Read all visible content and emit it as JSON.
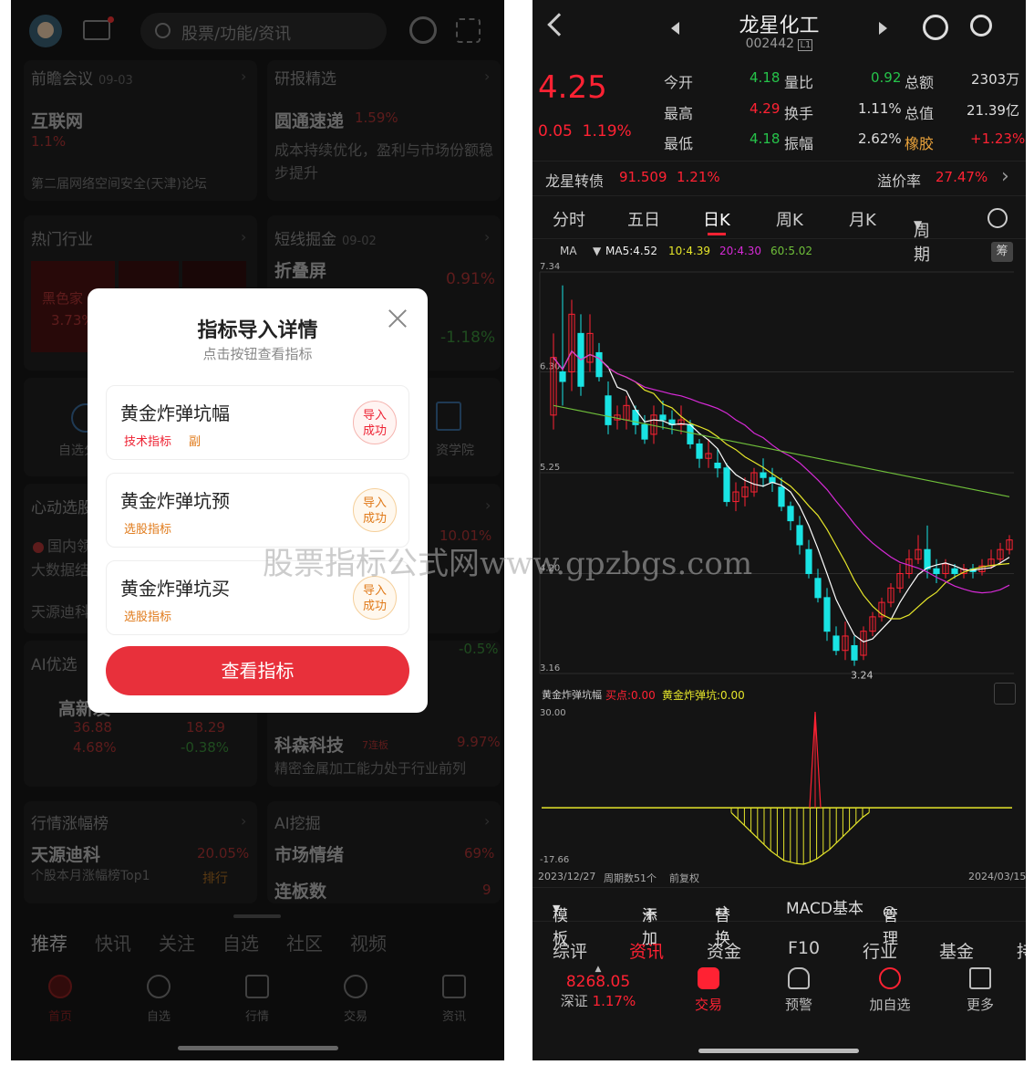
{
  "left": {
    "search_placeholder": "股票/功能/资讯",
    "cards": {
      "qianzhan": {
        "title": "前瞻会议",
        "date": "09-03",
        "main": "互联网",
        "pct": "1.1%",
        "desc": "第二届网络空间安全(天津)论坛"
      },
      "yanbao": {
        "title": "研报精选",
        "main": "圆通速递",
        "pct": "1.59%",
        "desc": "成本持续优化，盈利与市场份额稳步提升"
      },
      "remen": {
        "title": "热门行业",
        "item": "黑色家",
        "pct": "3.73%"
      },
      "duanxian": {
        "title": "短线掘金",
        "date": "09-02",
        "main": "折叠屏",
        "pct1": "0.91%",
        "pct2": "-1.18%"
      },
      "shortcuts": {
        "a": "自选分",
        "b": "资学院"
      },
      "xindong": {
        "title": "心动选股",
        "item1": "国内领",
        "item2": "大数据结",
        "pct": "10.01%",
        "item3": "天源迪科"
      },
      "aiyou": {
        "title": "AI优选",
        "stock1": "高新发",
        "v1": "36.88",
        "p1": "4.68%",
        "v2": "18.29",
        "p2": "-0.38%",
        "pct": "-0.5%"
      },
      "kesen": {
        "main": "科森科技",
        "tag": "7连板",
        "pct": "9.97%",
        "desc": "精密金属加工能力处于行业前列"
      },
      "zhangfu": {
        "title": "行情涨幅榜",
        "main": "天源迪科",
        "pct": "20.05%",
        "desc": "个股本月涨幅榜Top1",
        "link": "排行"
      },
      "aijue": {
        "title": "AI挖掘",
        "main": "市场情绪",
        "pct": "69%",
        "sub": "连板数",
        "num": "9"
      }
    },
    "tabs": [
      "推荐",
      "快讯",
      "关注",
      "自选",
      "社区",
      "视频"
    ],
    "nav": [
      "首页",
      "自选",
      "行情",
      "交易",
      "资讯"
    ]
  },
  "modal": {
    "title": "指标导入详情",
    "subtitle": "点击按钮查看指标",
    "items": [
      {
        "name": "黄金炸弹坑幅",
        "tag": "技术指标",
        "tag2": "副",
        "status": [
          "导入",
          "成功"
        ]
      },
      {
        "name": "黄金炸弹坑预",
        "tag": "选股指标",
        "status": [
          "导入",
          "成功"
        ]
      },
      {
        "name": "黄金炸弹坑买",
        "tag": "选股指标",
        "status": [
          "导入",
          "成功"
        ]
      }
    ],
    "button": "查看指标"
  },
  "right": {
    "stock_name": "龙星化工",
    "stock_code": "002442",
    "code_badge": "L1",
    "price": "4.25",
    "change": "0.05",
    "change_pct": "1.19%",
    "quote": {
      "open_label": "今开",
      "open": "4.18",
      "high_label": "最高",
      "high": "4.29",
      "low_label": "最低",
      "low": "4.18",
      "vr_label": "量比",
      "vr": "0.92",
      "turn_label": "换手",
      "turn": "1.11%",
      "amp_label": "振幅",
      "amp": "2.62%",
      "amt_label": "总额",
      "amt": "2303万",
      "cap_label": "总值",
      "cap": "21.39亿",
      "sector_label": "橡胶",
      "sector": "+1.23%"
    },
    "bond": {
      "name": "龙星转债",
      "price": "91.509",
      "pct": "1.21%",
      "premium_label": "溢价率",
      "premium": "27.47%"
    },
    "periods": [
      "分时",
      "五日",
      "日K",
      "周K",
      "月K",
      "周期"
    ],
    "ma": {
      "label": "MA",
      "ma5": "MA5:4.52",
      "ma10": "10:4.39",
      "ma20": "20:4.30",
      "ma60": "60:5.02",
      "chip": "筹"
    },
    "ind": {
      "name": "黄金炸弹坑幅",
      "buy": "买点:0.00",
      "pit": "黄金炸弹坑:0.00"
    },
    "dates": {
      "start": "2023/12/27",
      "count": "周期数51个",
      "adj": "前复权",
      "end": "2024/03/15"
    },
    "tools": [
      "模板",
      "添加",
      "替换",
      "MACD基本",
      "管理"
    ],
    "info_tabs": [
      "综评",
      "资讯",
      "资金",
      "F10",
      "行业",
      "基金",
      "持"
    ],
    "index": {
      "value": "8268.05",
      "name": "深证",
      "pct": "1.17%"
    },
    "nav": [
      "交易",
      "预警",
      "加自选",
      "更多"
    ]
  },
  "watermark": "股票指标公式网www.gpzbgs.com",
  "chart_data": [
    {
      "type": "candlestick",
      "title": "",
      "y_ticks": [
        "7.34",
        "6.30",
        "5.25",
        "4.20",
        "3.16"
      ],
      "ylim": [
        3.16,
        7.34
      ],
      "low_marker": "3.24",
      "ohlc": [
        [
          5.85,
          6.45,
          6.7,
          5.7
        ],
        [
          6.3,
          6.2,
          7.2,
          5.95
        ],
        [
          6.3,
          6.9,
          7.05,
          6.1
        ],
        [
          6.7,
          6.15,
          6.9,
          6.05
        ],
        [
          6.4,
          6.7,
          6.9,
          6.3
        ],
        [
          6.5,
          6.25,
          6.6,
          6.2
        ],
        [
          6.05,
          5.75,
          6.2,
          5.65
        ],
        [
          5.8,
          5.85,
          5.95,
          5.7
        ],
        [
          5.8,
          5.95,
          6.05,
          5.7
        ],
        [
          5.9,
          5.75,
          5.95,
          5.65
        ],
        [
          5.75,
          5.6,
          5.85,
          5.55
        ],
        [
          5.65,
          5.85,
          5.95,
          5.55
        ],
        [
          5.85,
          5.8,
          6.0,
          5.7
        ],
        [
          5.8,
          5.75,
          5.9,
          5.65
        ],
        [
          5.75,
          5.8,
          5.95,
          5.65
        ],
        [
          5.75,
          5.55,
          5.8,
          5.5
        ],
        [
          5.55,
          5.4,
          5.6,
          5.3
        ],
        [
          5.4,
          5.45,
          5.6,
          5.3
        ],
        [
          5.35,
          5.3,
          5.5,
          5.2
        ],
        [
          5.3,
          4.95,
          5.35,
          4.9
        ],
        [
          4.95,
          5.05,
          5.15,
          4.85
        ],
        [
          5.0,
          5.1,
          5.2,
          4.9
        ],
        [
          5.05,
          5.25,
          5.3,
          5.0
        ],
        [
          5.25,
          5.2,
          5.4,
          5.1
        ],
        [
          5.2,
          5.15,
          5.3,
          5.05
        ],
        [
          5.1,
          4.9,
          5.2,
          4.85
        ],
        [
          4.9,
          4.75,
          4.95,
          4.65
        ],
        [
          4.7,
          4.5,
          4.8,
          4.4
        ],
        [
          4.45,
          4.2,
          4.55,
          4.15
        ],
        [
          4.15,
          3.95,
          4.25,
          3.9
        ],
        [
          3.95,
          3.6,
          4.05,
          3.5
        ],
        [
          3.55,
          3.4,
          3.65,
          3.35
        ],
        [
          3.4,
          3.55,
          3.7,
          3.3
        ],
        [
          3.45,
          3.3,
          3.55,
          3.24
        ],
        [
          3.35,
          3.6,
          3.65,
          3.3
        ],
        [
          3.6,
          3.75,
          3.8,
          3.55
        ],
        [
          3.75,
          3.9,
          3.95,
          3.7
        ],
        [
          3.9,
          4.05,
          4.1,
          3.85
        ],
        [
          4.05,
          4.2,
          4.3,
          4.0
        ],
        [
          4.2,
          4.35,
          4.45,
          4.15
        ],
        [
          4.35,
          4.45,
          4.6,
          4.3
        ],
        [
          4.45,
          4.25,
          4.7,
          4.15
        ],
        [
          4.25,
          4.2,
          4.35,
          4.1
        ],
        [
          4.2,
          4.3,
          4.35,
          4.15
        ],
        [
          4.25,
          4.2,
          4.3,
          4.15
        ],
        [
          4.2,
          4.25,
          4.3,
          4.15
        ],
        [
          4.25,
          4.22,
          4.3,
          4.15
        ],
        [
          4.22,
          4.28,
          4.35,
          4.18
        ],
        [
          4.28,
          4.35,
          4.45,
          4.25
        ],
        [
          4.35,
          4.45,
          4.52,
          4.3
        ],
        [
          4.45,
          4.55,
          4.6,
          4.4
        ]
      ],
      "series": [
        {
          "name": "MA5",
          "color": "#ffffff"
        },
        {
          "name": "MA10",
          "color": "#e6e62a"
        },
        {
          "name": "MA20",
          "color": "#d62ad6"
        },
        {
          "name": "MA60",
          "color": "#6fbf3a"
        }
      ]
    },
    {
      "type": "bar",
      "title": "",
      "y_ticks": [
        "30.00",
        "-17.66"
      ],
      "ylim": [
        -17.66,
        30.0
      ],
      "spike_value": 30.0,
      "pit_values": [
        -1.5,
        -3.5,
        -5.5,
        -7.5,
        -9.5,
        -11.5,
        -13.5,
        -15.0,
        -16.5,
        -17.0,
        -17.5,
        -17.66,
        -17.0,
        -16.0,
        -14.5,
        -13.0,
        -11.0,
        -9.0,
        -7.0,
        -5.0,
        -3.0,
        -1.5
      ]
    }
  ]
}
